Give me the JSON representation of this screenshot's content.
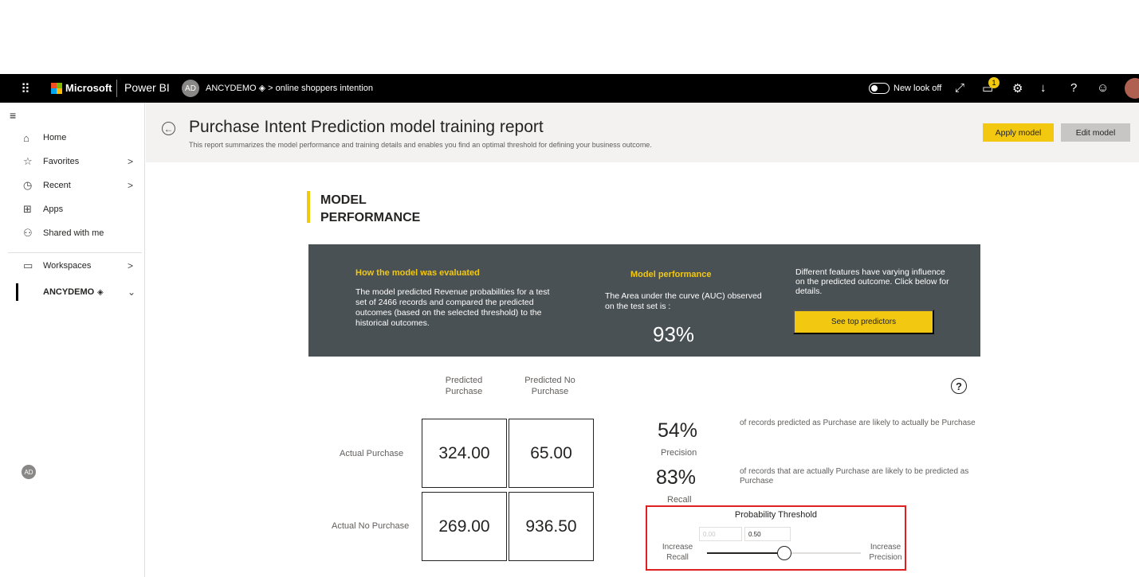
{
  "topbar": {
    "brand": "Microsoft",
    "app": "Power BI",
    "workspace_initials": "AD",
    "breadcrumb_workspace": "ANCYDEMO",
    "breadcrumb_item": "online shoppers intention",
    "new_look": "New look off",
    "notification_count": "1",
    "colors": {
      "bg": "#000000",
      "accent": "#f2c811"
    }
  },
  "sidebar": {
    "items": [
      {
        "label": "Home",
        "icon": "home-icon"
      },
      {
        "label": "Favorites",
        "icon": "star-icon"
      },
      {
        "label": "Recent",
        "icon": "clock-icon"
      },
      {
        "label": "Apps",
        "icon": "apps-icon"
      },
      {
        "label": "Shared with me",
        "icon": "shared-icon"
      },
      {
        "label": "Workspaces",
        "icon": "workspaces-icon"
      },
      {
        "label": "ANCYDEMO",
        "icon": "workspace-avatar"
      }
    ]
  },
  "header": {
    "title": "Purchase Intent Prediction model training report",
    "subtitle": "This report summarizes the model performance and training details and enables you find an optimal threshold for defining your business outcome.",
    "apply_label": "Apply model",
    "edit_label": "Edit model"
  },
  "section": {
    "title": "MODEL PERFORMANCE"
  },
  "panel": {
    "eval_heading": "How the model was evaluated",
    "eval_text": "The model predicted Revenue probabilities for a test set of 2466 records and compared the predicted outcomes (based on the selected threshold) to the historical outcomes.",
    "perf_heading": "Model performance",
    "perf_text": "The Area under the curve (AUC) observed on the test set is :",
    "auc": "93%",
    "features_text": "Different features have varying influence on the predicted outcome.  Click below for details.",
    "predictors_button": "See top predictors"
  },
  "matrix": {
    "col_headers": [
      "Predicted Purchase",
      "Predicted No Purchase"
    ],
    "row_headers": [
      "Actual Purchase",
      "Actual No Purchase"
    ],
    "cells": [
      [
        "324.00",
        "65.00"
      ],
      [
        "269.00",
        "936.50"
      ]
    ]
  },
  "metrics": {
    "precision_value": "54%",
    "precision_label": "Precision",
    "precision_desc": "of records predicted as Purchase are likely to actually be Purchase",
    "recall_value": "83%",
    "recall_label": "Recall",
    "recall_desc": "of records that are actually Purchase are likely to be predicted as Purchase"
  },
  "threshold": {
    "title": "Probability Threshold",
    "min_value": "0.00",
    "current_value": "0.50",
    "left_label": "Increase Recall",
    "right_label": "Increase Precision",
    "fraction": 0.5
  }
}
